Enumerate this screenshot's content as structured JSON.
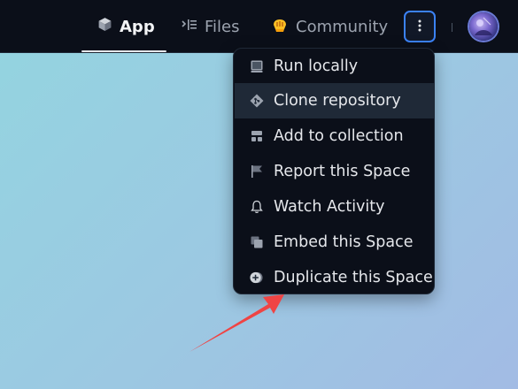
{
  "nav": {
    "tabs": [
      {
        "label": "App",
        "icon": "cube-icon",
        "active": true
      },
      {
        "label": "Files",
        "icon": "files-list-icon",
        "active": false
      },
      {
        "label": "Community",
        "icon": "community-hands-icon",
        "active": false
      }
    ],
    "more_button_icon": "vertical-dots-icon",
    "avatar_icon": "user-avatar"
  },
  "menu": {
    "items": [
      {
        "label": "Run locally",
        "icon": "terminal-icon"
      },
      {
        "label": "Clone repository",
        "icon": "git-icon",
        "highlighted": true
      },
      {
        "label": "Add to collection",
        "icon": "collection-icon"
      },
      {
        "label": "Report this Space",
        "icon": "flag-icon"
      },
      {
        "label": "Watch Activity",
        "icon": "bell-icon"
      },
      {
        "label": "Embed this Space",
        "icon": "embed-icon"
      },
      {
        "label": "Duplicate this Space",
        "icon": "duplicate-icon"
      }
    ]
  },
  "colors": {
    "nav_bg": "#0b0f19",
    "menu_bg": "#0b0f19",
    "menu_hover": "#1f2937",
    "focus_ring": "#3b82f6",
    "annotation_arrow": "#ef4444",
    "background_gradient_start": "#93d5e0",
    "background_gradient_end": "#a2bbe4"
  }
}
